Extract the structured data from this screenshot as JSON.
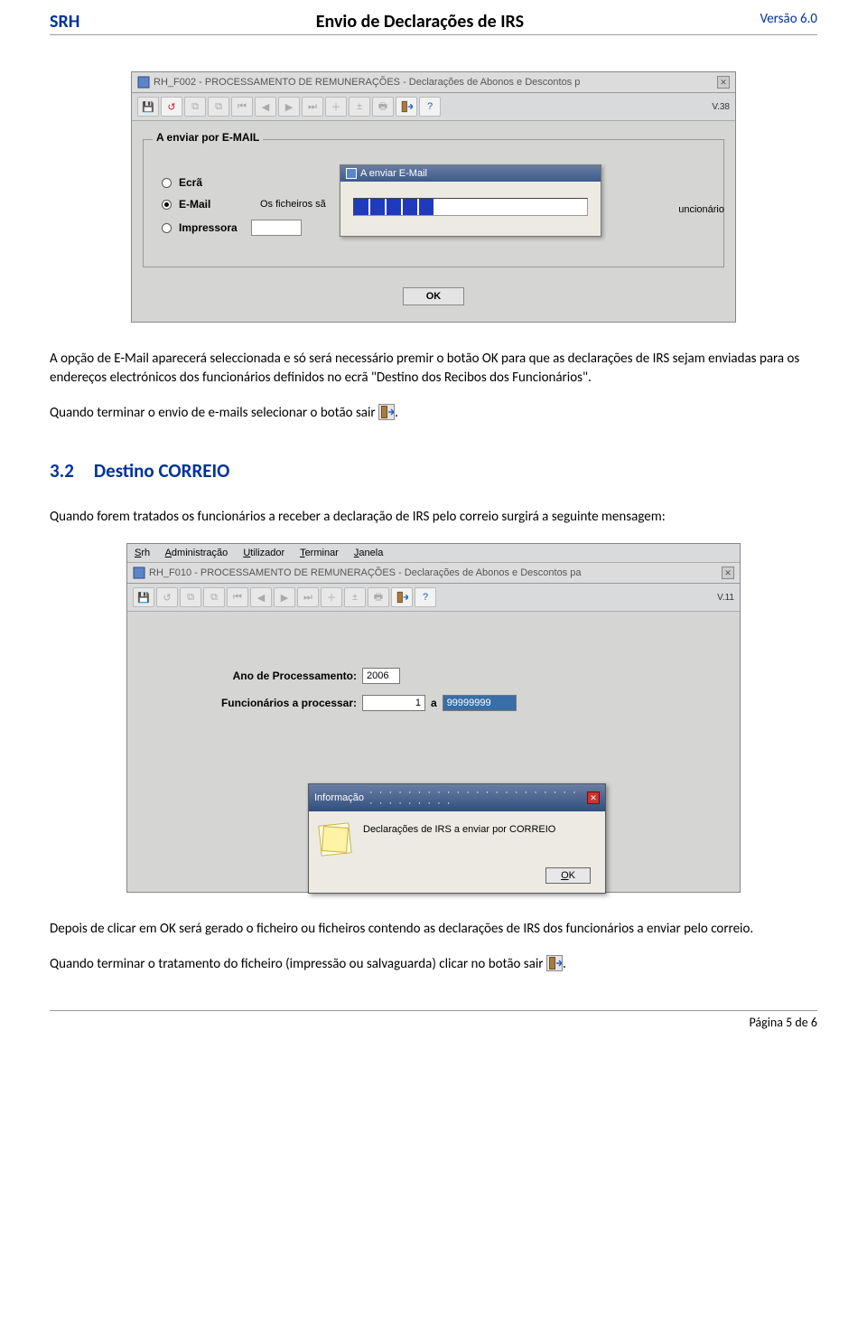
{
  "header": {
    "left": "SRH",
    "center": "Envio de Declarações de IRS",
    "right": "Versão 6.0"
  },
  "win1": {
    "title": "RH_F002 - PROCESSAMENTO DE REMUNERAÇÕES - Declarações de Abonos e Descontos p",
    "version": "V.38",
    "group_legend": "A enviar por E-MAIL",
    "radios": {
      "ecra": "Ecrã",
      "email": "E-Mail",
      "impressora": "Impressora"
    },
    "files_text": "Os ficheiros sã",
    "right_frag": "uncionário",
    "progress_title": "A enviar E-Mail",
    "ok": "OK"
  },
  "para1": "A opção de E-Mail aparecerá seleccionada e só será necessário premir o botão OK para que as declarações de IRS sejam enviadas para os endereços electrónicos dos funcionários definidos no ecrã \"Destino dos Recibos dos Funcionários\".",
  "para2_a": "Quando terminar o envio de e-mails selecionar o botão sair ",
  "para2_b": ".",
  "section": {
    "num": "3.2",
    "title": "Destino CORREIO"
  },
  "para3": "Quando forem tratados os funcionários a receber a declaração de IRS pelo correio surgirá a seguinte mensagem:",
  "win2": {
    "menus": [
      "Srh",
      "Administração",
      "Utilizador",
      "Terminar",
      "Janela"
    ],
    "title": "RH_F010 - PROCESSAMENTO DE REMUNERAÇÕES - Declarações de Abonos e Descontos pa",
    "version": "V.11",
    "ano_lbl": "Ano de Processamento:",
    "ano_val": "2006",
    "func_lbl": "Funcionários a processar:",
    "func_from": "1",
    "func_sep": "a",
    "func_to": "99999999",
    "dlg_title": "Informação",
    "dlg_text": "Declarações de IRS a enviar por CORREIO",
    "dlg_ok": "OK"
  },
  "para4": "Depois de clicar em OK será gerado o ficheiro ou ficheiros contendo as declarações de IRS dos funcionários a enviar pelo correio.",
  "para5_a": "Quando terminar o tratamento do ficheiro (impressão ou salvaguarda) clicar no botão sair ",
  "para5_b": ".",
  "footer": {
    "page": "Página 5 de 6"
  }
}
